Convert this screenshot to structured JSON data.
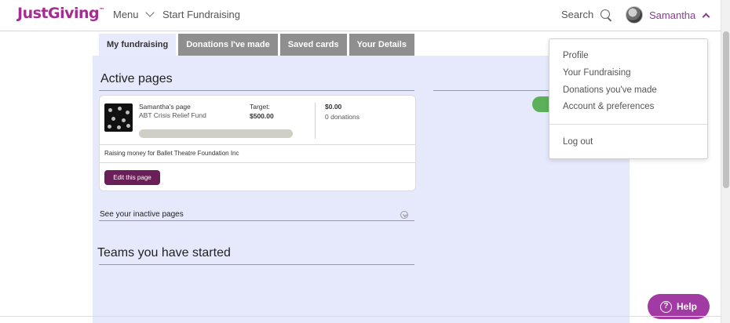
{
  "header": {
    "logo": "JustGiving",
    "logo_tm": "™",
    "menu_label": "Menu",
    "start_fundraising": "Start Fundraising",
    "search_label": "Search",
    "user_name": "Samantha"
  },
  "tabs": [
    {
      "label": "My fundraising",
      "active": true
    },
    {
      "label": "Donations I've made",
      "active": false
    },
    {
      "label": "Saved cards",
      "active": false
    },
    {
      "label": "Your Details",
      "active": false
    }
  ],
  "active_pages": {
    "title": "Active pages",
    "card": {
      "page_name": "Samantha's page",
      "fund_name": "ABT Crisis Relief Fund",
      "target_label": "Target:",
      "target_value": "$500.00",
      "raised": "$0.00",
      "donations": "0 donations",
      "raising_for": "Raising money for Ballet Theatre Foundation Inc",
      "edit_button": "Edit this page",
      "progress_fraction": 0
    }
  },
  "inactive": {
    "label": "See your inactive pages"
  },
  "teams": {
    "title": "Teams you have started"
  },
  "dropdown": {
    "items": [
      "Profile",
      "Your Fundraising",
      "Donations you've made",
      "Account & preferences"
    ],
    "logout": "Log out"
  },
  "help": {
    "label": "Help",
    "icon_glyph": "?"
  },
  "colors": {
    "brand": "#a52c90",
    "panel_bg": "#e6e9fb",
    "edit_button": "#6b1f58",
    "help_button": "#a13aa3",
    "tab_inactive": "#8f8f8f"
  }
}
